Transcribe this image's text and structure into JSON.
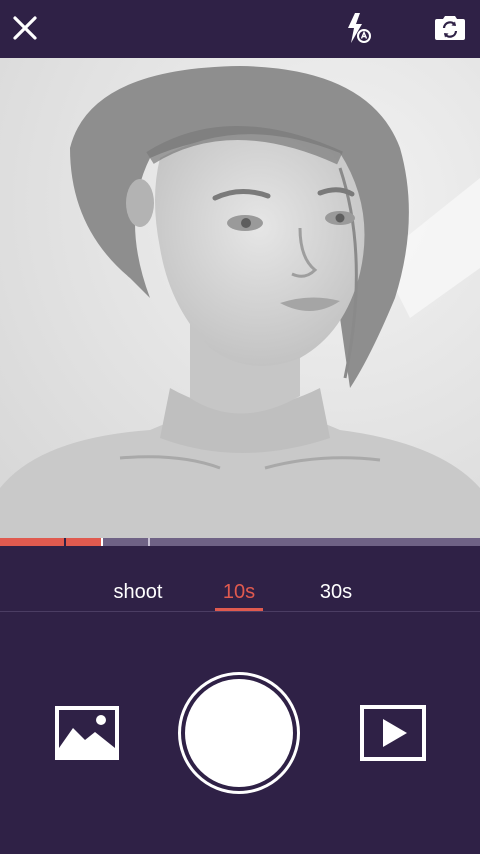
{
  "top_bar": {
    "close_icon": "close-icon",
    "flash_icon": "flash-auto-icon",
    "camera_icon": "camera-switch-icon"
  },
  "viewfinder": {
    "content": "camera-preview"
  },
  "recording_progress": {
    "recorded_fraction": 0.21,
    "fill_color": "#e05a4f",
    "track_color": "#6f6285"
  },
  "mode_tabs": [
    {
      "label": "shoot",
      "active": false
    },
    {
      "label": "10s",
      "active": true
    },
    {
      "label": "30s",
      "active": false
    }
  ],
  "bottom_controls": {
    "gallery_icon": "gallery-image-icon",
    "record_icon": "shutter-record-icon",
    "play_icon": "play-preview-icon"
  },
  "colors": {
    "background": "#2f2146",
    "accent": "#e05a4f",
    "text": "#ffffff"
  }
}
